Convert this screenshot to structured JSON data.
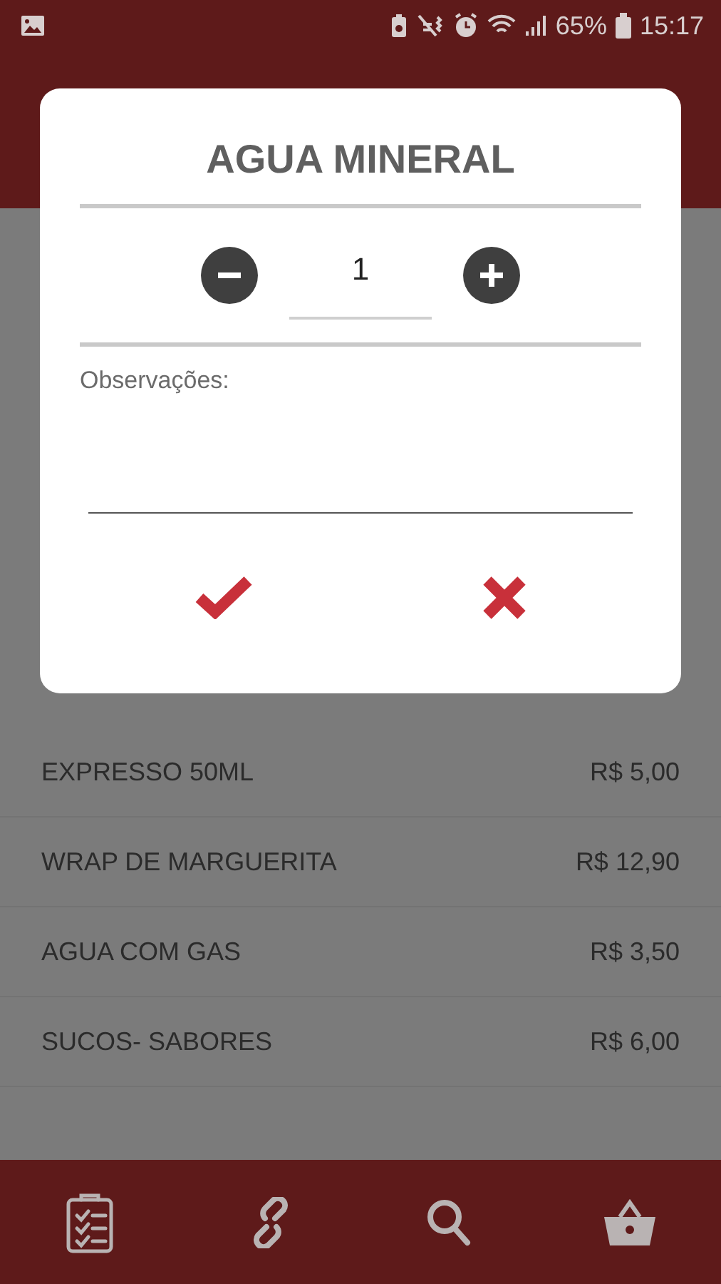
{
  "status_bar": {
    "battery": "65%",
    "time": "15:17"
  },
  "dialog": {
    "title": "AGUA MINERAL",
    "quantity": "1",
    "notes_label": "Observações:"
  },
  "menu_items": [
    {
      "name": "EXPRESSO 50ML",
      "price": "R$ 5,00"
    },
    {
      "name": "WRAP DE MARGUERITA",
      "price": "R$ 12,90"
    },
    {
      "name": "AGUA COM GAS",
      "price": "R$ 3,50"
    },
    {
      "name": "SUCOS- SABORES",
      "price": "R$ 6,00"
    }
  ],
  "bottom_nav": [
    {
      "kind": "checklist"
    },
    {
      "kind": "link"
    },
    {
      "kind": "search"
    },
    {
      "kind": "basket"
    }
  ]
}
